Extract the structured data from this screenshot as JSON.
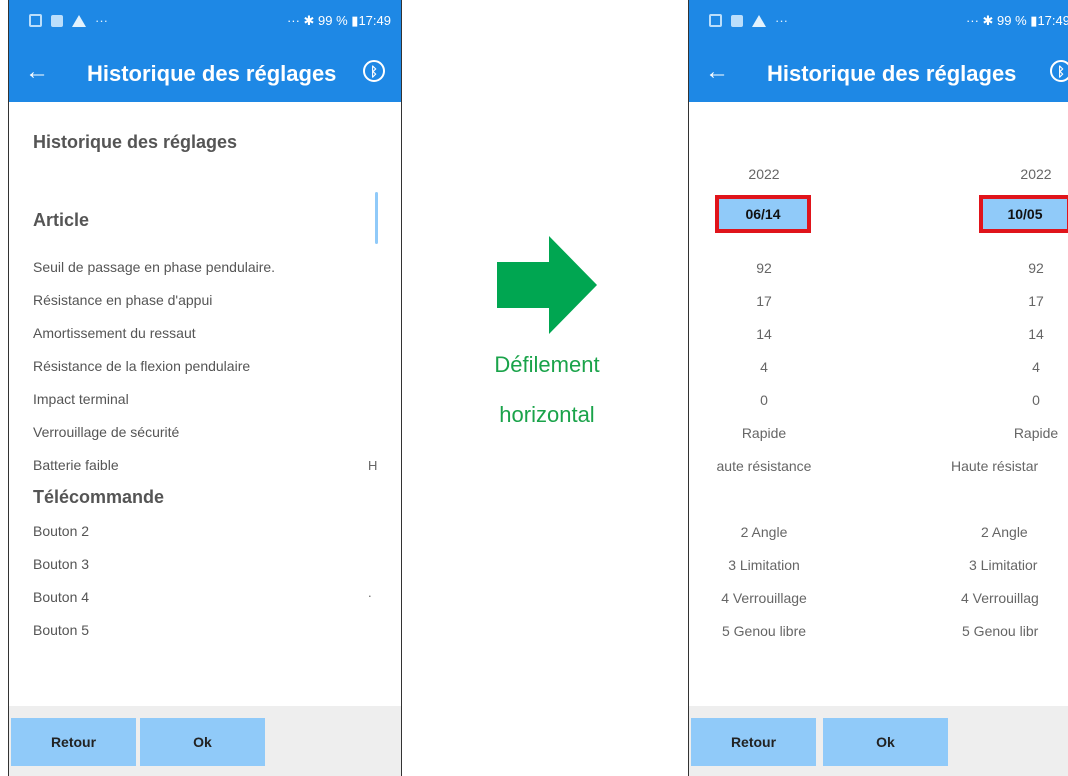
{
  "status_bar": {
    "right_text": "··· ✱ 99 % ▮17:49"
  },
  "app_bar": {
    "title": "Historique des réglages"
  },
  "left_screen": {
    "page_heading": "Historique des réglages",
    "article_heading": "Article",
    "article_items": [
      "Seuil de passage en phase pendulaire.",
      "Résistance en phase d'appui",
      "Amortissement du ressaut",
      "Résistance de la flexion pendulaire",
      "Impact terminal",
      "Verrouillage de sécurité",
      "Batterie faible"
    ],
    "remote_heading": "Télécommande",
    "remote_items": [
      "Bouton 2",
      "Bouton 3",
      "Bouton 4",
      "Bouton 5"
    ],
    "edge_chars": {
      "battery_row": "H",
      "bouton4_row": "."
    }
  },
  "annotation": {
    "line1": "Défilement",
    "line2": "horizontal",
    "arrow_color": "#00a651"
  },
  "right_screen": {
    "columns": [
      {
        "year": "2022",
        "date": "06/14",
        "values": [
          "92",
          "17",
          "14",
          "4",
          "0",
          "Rapide",
          "aute résistance"
        ],
        "remote": [
          "2 Angle",
          "3 Limitation",
          "4 Verrouillage",
          "5 Genou libre"
        ]
      },
      {
        "year": "2022",
        "date": "10/05",
        "values": [
          "92",
          "17",
          "14",
          "4",
          "0",
          "Rapide",
          "Haute résistar"
        ],
        "remote": [
          "2 Angle",
          "3 Limitatior",
          "4 Verrouillag",
          "5 Genou libr"
        ]
      }
    ]
  },
  "buttons": {
    "back": "Retour",
    "ok": "Ok"
  },
  "colors": {
    "primary": "#1e88e5",
    "button": "#90caf9",
    "highlight_border": "#e0141b"
  }
}
